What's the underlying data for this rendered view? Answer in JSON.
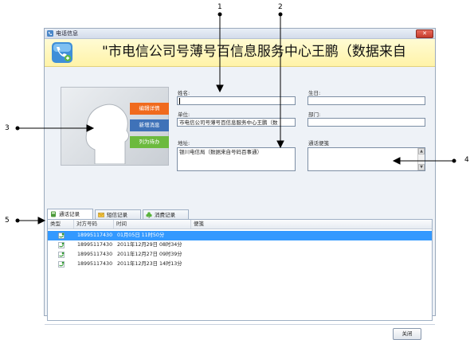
{
  "window": {
    "title": "电话信息"
  },
  "banner": {
    "caller_text": "\"市电信公司号薄号百信息服务中心王鹏（数据来自"
  },
  "avatar": {
    "buttons": {
      "edit": "编辑详情",
      "sms": "新增消息",
      "blacklist": "列为待办"
    }
  },
  "form": {
    "name_label": "姓名:",
    "name_value": "",
    "birthday_label": "生日:",
    "birthday_value": "",
    "company_label": "单位:",
    "company_value": "市电信公司号薄号百信息服务中心王鹏（数",
    "department_label": "部门:",
    "department_value": "",
    "address_label": "地址:",
    "address_value": "银川电信局（数据来自号码百事通）",
    "note_label": "通话便笺",
    "note_value": ""
  },
  "tabs": [
    {
      "label": "通话记录",
      "active": true
    },
    {
      "label": "短信记录",
      "active": false
    },
    {
      "label": "消费记录",
      "active": false
    }
  ],
  "table": {
    "columns": [
      "类型",
      "对方号码",
      "时间",
      "便笺"
    ],
    "rows": [
      {
        "number": "18995117430",
        "time": "01月05日  11时50分",
        "note": "",
        "selected": true
      },
      {
        "number": "18995117430",
        "time": "2011年12月29日  08时34分",
        "note": "",
        "selected": false
      },
      {
        "number": "18995117430",
        "time": "2011年12月27日  09时39分",
        "note": "",
        "selected": false
      },
      {
        "number": "18995117430",
        "time": "2011年12月23日  14时13分",
        "note": "",
        "selected": false
      }
    ]
  },
  "footer": {
    "close_label": "关闭"
  },
  "callouts": {
    "n1": "1",
    "n2": "2",
    "n3": "3",
    "n4": "4",
    "n5": "5"
  },
  "colors": {
    "selection": "#3399ff",
    "banner_bg": "#fff3a8",
    "edit_btn": "#f06a1d",
    "sms_btn": "#3f72b8",
    "blacklist_btn": "#6cba3e"
  }
}
